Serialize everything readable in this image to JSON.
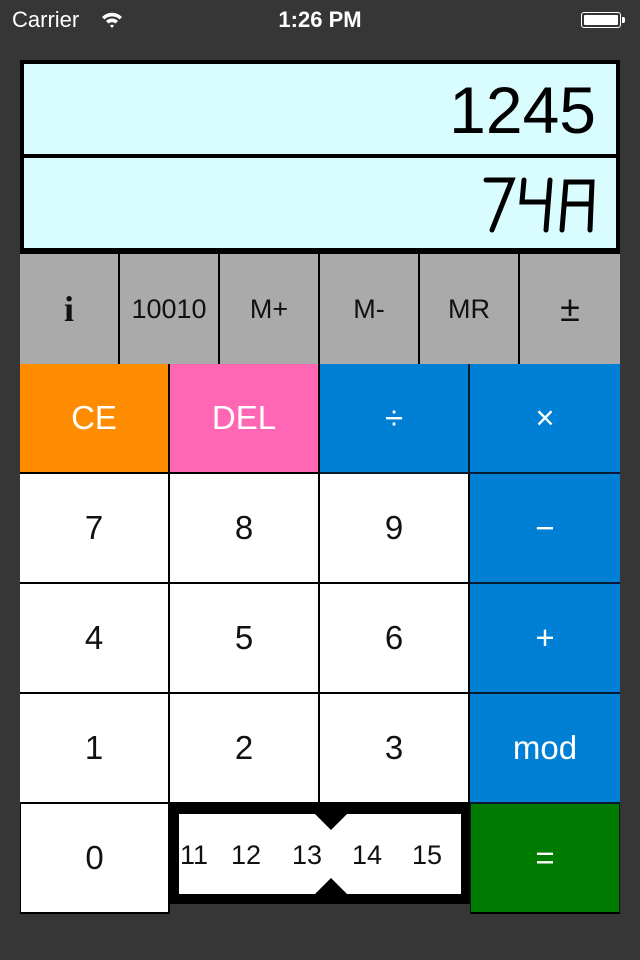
{
  "status_bar": {
    "carrier": "Carrier",
    "time": "1:26 PM",
    "battery_percent": 100
  },
  "display": {
    "primary_value": "1245",
    "secondary_value": "74A"
  },
  "function_row": [
    {
      "id": "info",
      "label": "i",
      "icon": "info-icon"
    },
    {
      "id": "binary",
      "label": "10010"
    },
    {
      "id": "mem-plus",
      "label": "M+"
    },
    {
      "id": "mem-minus",
      "label": "M-"
    },
    {
      "id": "mem-recall",
      "label": "MR"
    },
    {
      "id": "sign",
      "label": "±"
    }
  ],
  "keypad": {
    "ce": "CE",
    "del": "DEL",
    "divide": "÷",
    "multiply": "×",
    "seven": "7",
    "eight": "8",
    "nine": "9",
    "minus": "−",
    "four": "4",
    "five": "5",
    "six": "6",
    "plus": "+",
    "one": "1",
    "two": "2",
    "three": "3",
    "mod": "mod",
    "zero": "0",
    "equals": "="
  },
  "base_picker": {
    "items": [
      "11",
      "12",
      "13",
      "14",
      "15"
    ],
    "selected": "13"
  },
  "colors": {
    "background": "#363636",
    "display": "#d9fdff",
    "function_row": "#aaaaaa",
    "clear": "#ff8c00",
    "delete": "#ff66b3",
    "operator": "#0080d4",
    "equals": "#007a00"
  }
}
